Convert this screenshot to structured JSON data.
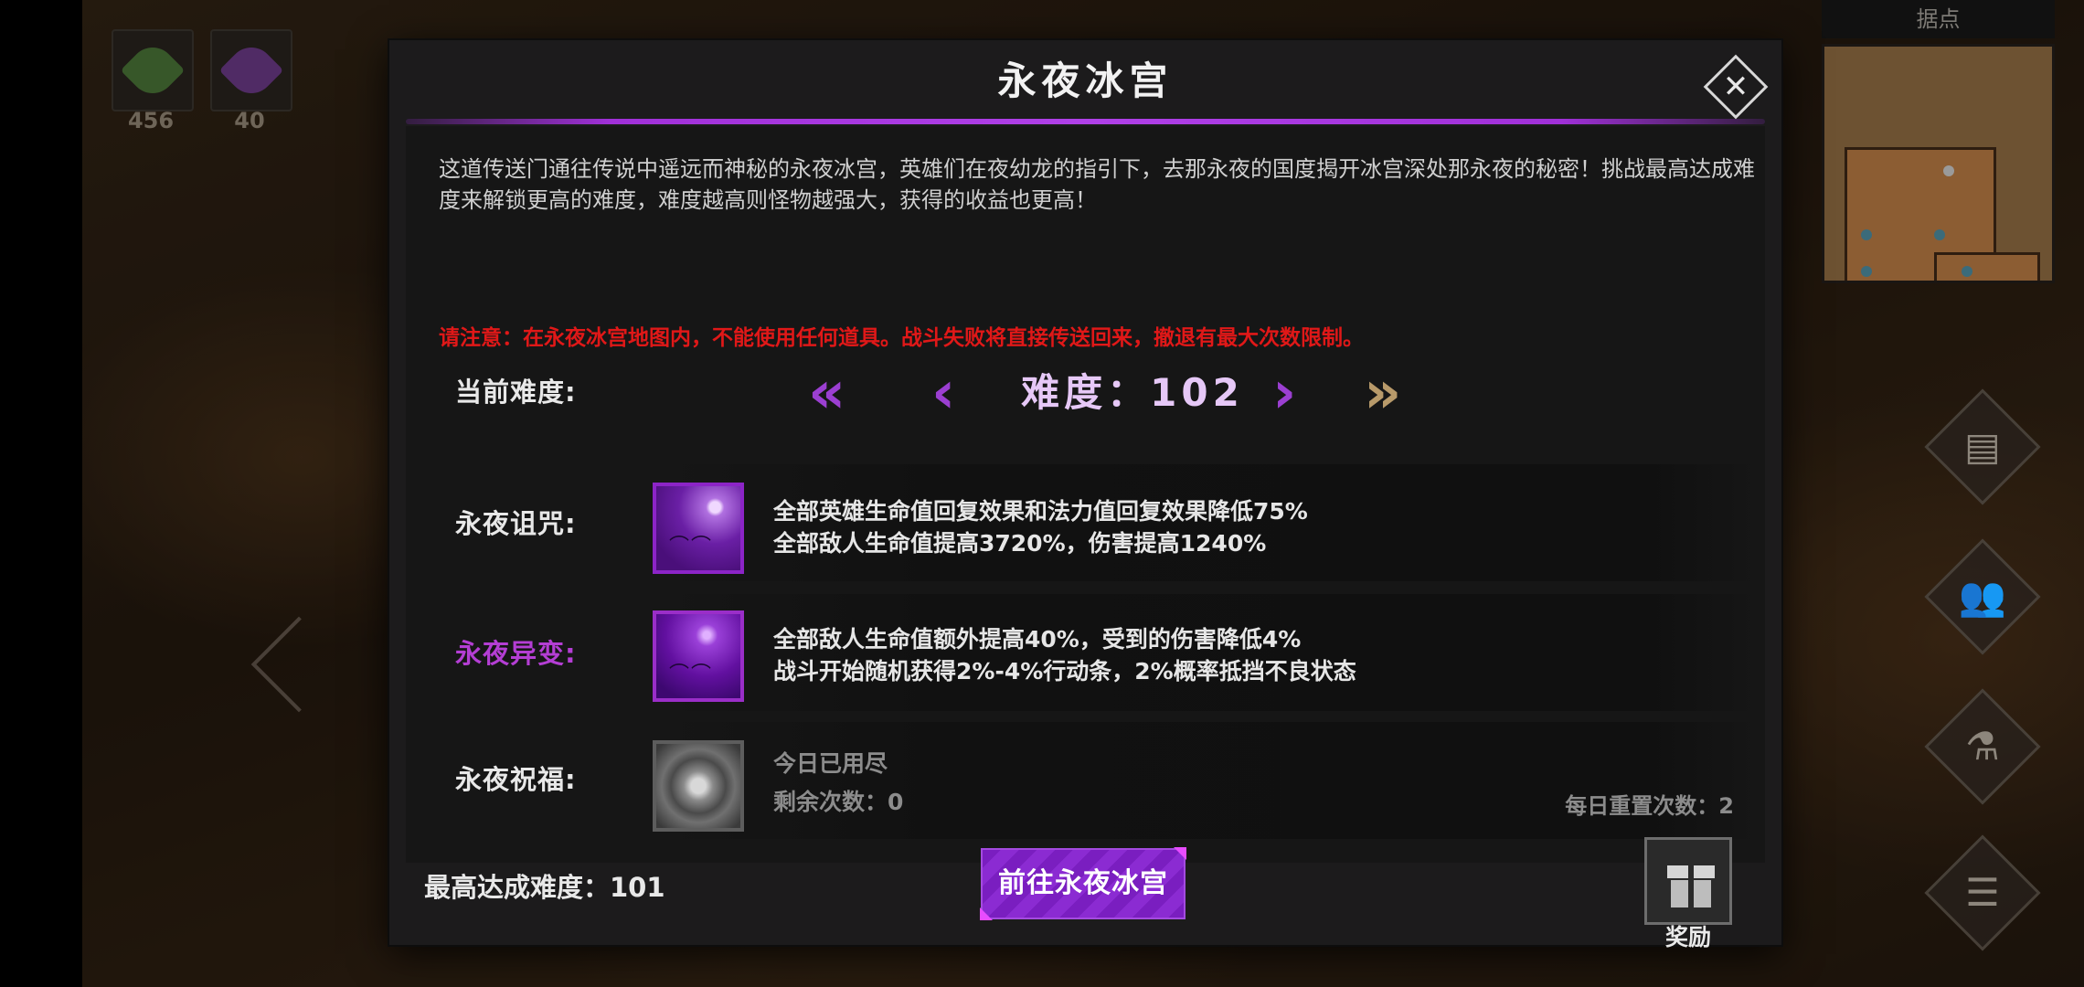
{
  "resources": [
    {
      "icon": "green-feather-icon",
      "count": "456",
      "color": "#4d8a3a"
    },
    {
      "icon": "purple-feather-icon",
      "count": "40",
      "color": "#7a3aa8"
    }
  ],
  "minimap": {
    "title": "据点"
  },
  "side_buttons": [
    {
      "icon": "scroll-icon",
      "glyph": "▤"
    },
    {
      "icon": "friends-icon",
      "glyph": "👥"
    },
    {
      "icon": "potion-icon",
      "glyph": "⚗"
    },
    {
      "icon": "list-menu-icon",
      "glyph": "☰"
    }
  ],
  "modal": {
    "title": "永夜冰宫",
    "close_glyph": "✕",
    "description": "这道传送门通往传说中遥远而神秘的永夜冰宫，英雄们在夜幼龙的指引下，去那永夜的国度揭开冰宫深处那永夜的秘密！挑战最高达成难度来解锁更高的难度，难度越高则怪物越强大，获得的收益也更高！",
    "warning": "请注意：在永夜冰宫地图内，不能使用任何道具。战斗失败将直接传送回来，撤退有最大次数限制。",
    "difficulty": {
      "label": "当前难度:",
      "value_text": "难度：102",
      "first_glyph": "«",
      "prev_glyph": "‹",
      "next_glyph": "›",
      "last_glyph": "»"
    },
    "curse": {
      "label": "永夜诅咒:",
      "line1": "全部英雄生命值回复效果和法力值回复效果降低75%",
      "line2": "全部敌人生命值提高3720%，伤害提高1240%"
    },
    "mutation": {
      "label": "永夜异变:",
      "line1": "全部敌人生命值额外提高40%，受到的伤害降低4%",
      "line2": "战斗开始随机获得2%-4%行动条，2%概率抵挡不良状态"
    },
    "blessing": {
      "label": "永夜祝福:",
      "status": "今日已用尽",
      "remaining": "剩余次数：0",
      "daily_reset": "每日重置次数：2"
    },
    "best": "最高达成难度：101",
    "go_button": "前往永夜冰宫",
    "reward_label": "奖励"
  },
  "colors": {
    "accent_purple": "#9b3fd1",
    "warning_red": "#e01818",
    "mutation_label": "#b43ed4",
    "gold_arrow": "#b89a6a"
  }
}
